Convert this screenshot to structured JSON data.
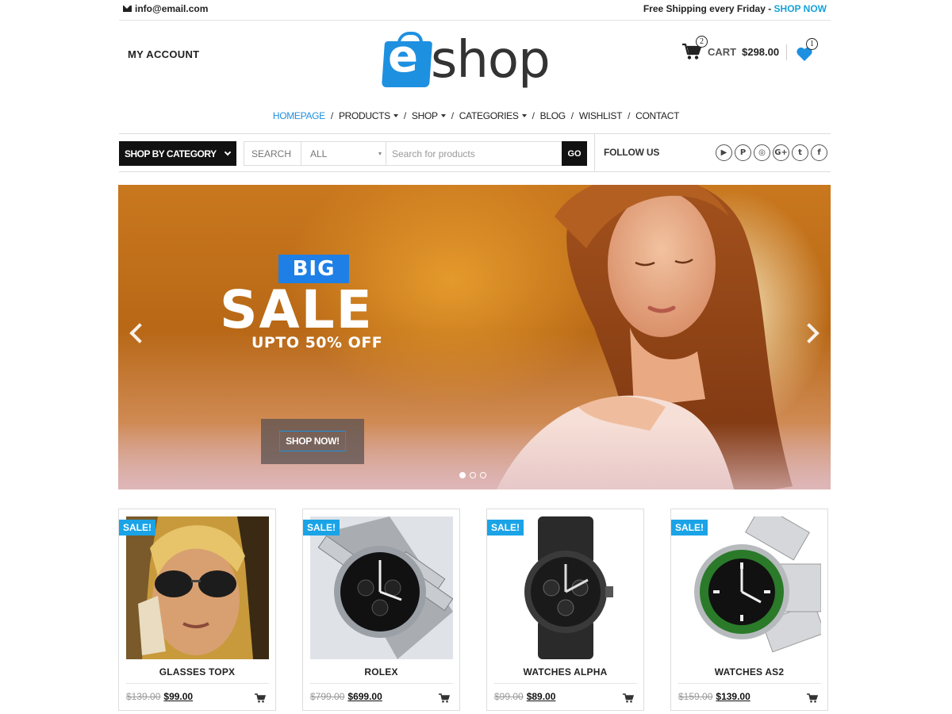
{
  "topbar": {
    "email": "info@email.com",
    "promo_text": "Free Shipping every Friday - ",
    "promo_link": "SHOP NOW"
  },
  "header": {
    "my_account": "MY ACCOUNT",
    "logo_letter": "e",
    "logo_word": "shop",
    "cart_count": "2",
    "cart_label": "CART",
    "cart_total": "$298.00",
    "wishlist_count": "1"
  },
  "nav": {
    "items": [
      {
        "label": "HOMEPAGE",
        "active": true,
        "dropdown": false
      },
      {
        "label": "PRODUCTS",
        "active": false,
        "dropdown": true
      },
      {
        "label": "SHOP",
        "active": false,
        "dropdown": true
      },
      {
        "label": "CATEGORIES",
        "active": false,
        "dropdown": true
      },
      {
        "label": "BLOG",
        "active": false,
        "dropdown": false
      },
      {
        "label": "WISHLIST",
        "active": false,
        "dropdown": false
      },
      {
        "label": "CONTACT",
        "active": false,
        "dropdown": false
      }
    ],
    "separator": "/"
  },
  "toolbar": {
    "category_button": "SHOP BY CATEGORY",
    "search_label": "SEARCH",
    "search_select": "ALL",
    "search_placeholder": "Search for products",
    "go_label": "GO",
    "follow_label": "FOLLOW US",
    "socials": [
      {
        "icon": "youtube-icon",
        "glyph": "▶"
      },
      {
        "icon": "pinterest-icon",
        "glyph": "P"
      },
      {
        "icon": "instagram-icon",
        "glyph": "◎"
      },
      {
        "icon": "google-plus-icon",
        "glyph": "G+"
      },
      {
        "icon": "twitter-icon",
        "glyph": "t"
      },
      {
        "icon": "facebook-icon",
        "glyph": "f"
      }
    ]
  },
  "hero": {
    "big": "BIG",
    "sale": "SALE",
    "subtitle": "UPTO 50% OFF",
    "cta": "SHOP NOW!",
    "slides": 3,
    "active_slide": 1
  },
  "products": [
    {
      "name": "GLASSES TOPX",
      "old_price": "$139.00",
      "new_price": "$99.00",
      "badge": "SALE!"
    },
    {
      "name": "ROLEX",
      "old_price": "$799.00",
      "new_price": "$699.00",
      "badge": "SALE!"
    },
    {
      "name": "WATCHES ALPHA",
      "old_price": "$99.00",
      "new_price": "$89.00",
      "badge": "SALE!"
    },
    {
      "name": "WATCHES AS2",
      "old_price": "$159.00",
      "new_price": "$139.00",
      "badge": "SALE!"
    }
  ],
  "colors": {
    "accent": "#1e90e0",
    "sale_badge": "#1aa3e6",
    "dark": "#111111"
  }
}
